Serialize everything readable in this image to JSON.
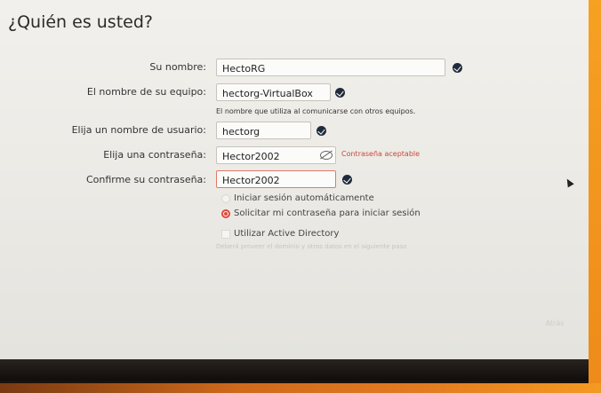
{
  "page": {
    "title": "¿Quién es usted?"
  },
  "form": {
    "name": {
      "label": "Su nombre:",
      "value": "HectoRG"
    },
    "computer": {
      "label": "El nombre de su equipo:",
      "value": "hectorg-VirtualBox",
      "hint": "El nombre que utiliza al comunicarse con otros equipos."
    },
    "username": {
      "label": "Elija un nombre de usuario:",
      "value": "hectorg"
    },
    "password": {
      "label": "Elija una contraseña:",
      "value": "Hector2002",
      "strength": "Contraseña aceptable"
    },
    "confirm": {
      "label": "Confirme su contraseña:",
      "value": "Hector2002"
    }
  },
  "options": {
    "auto_login": "Iniciar sesión automáticamente",
    "require_password": "Solicitar mi contraseña para iniciar sesión",
    "active_directory": "Utilizar Active Directory",
    "active_directory_note": "Deberá proveer el dominio y otros datos en el siguiente paso"
  },
  "buttons": {
    "back": "Atrás"
  },
  "colors": {
    "accent": "#e0493a",
    "ok": "#1f2a3a",
    "orange": "#ee8a1a"
  }
}
